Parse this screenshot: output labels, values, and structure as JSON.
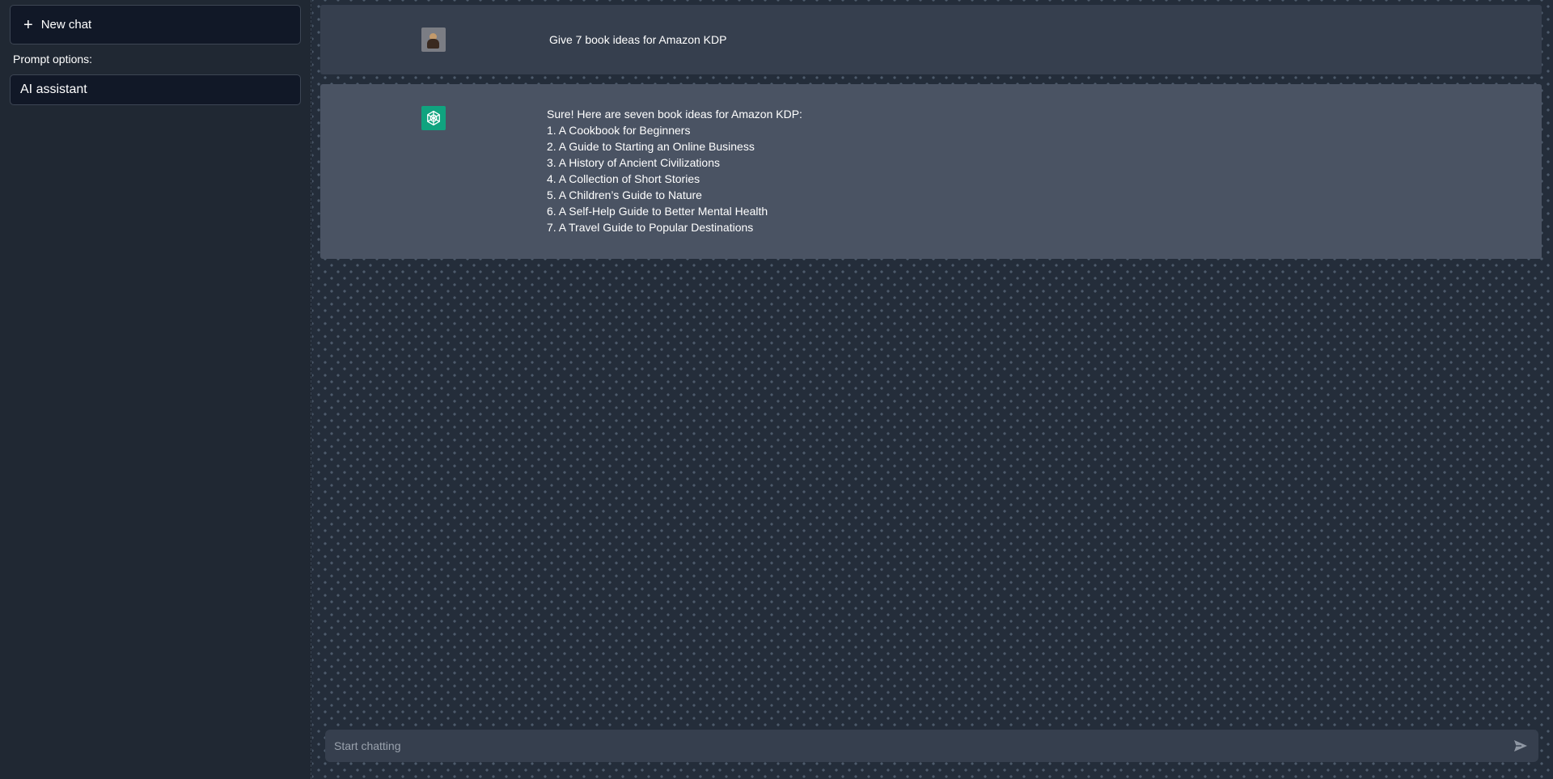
{
  "sidebar": {
    "new_chat_label": "New chat",
    "prompt_options_label": "Prompt options:",
    "prompt_selected": "AI assistant"
  },
  "chat": {
    "user_message": "Give 7 book ideas for Amazon KDP",
    "assistant_lines": [
      "Sure! Here are seven book ideas for Amazon KDP:",
      "1. A Cookbook for Beginners",
      "2. A Guide to Starting an Online Business",
      "3. A History of Ancient Civilizations",
      "4. A Collection of Short Stories",
      "5. A Children’s Guide to Nature",
      "6. A Self-Help Guide to Better Mental Health",
      "7. A Travel Guide to Popular Destinations"
    ]
  },
  "input": {
    "placeholder": "Start chatting",
    "value": ""
  },
  "icons": {
    "plus": "plus-icon",
    "user_avatar": "user-avatar-icon",
    "assistant_avatar": "openai-logo-icon",
    "send": "send-icon"
  },
  "colors": {
    "accent": "#10a37f",
    "sidebar_bg": "#202833",
    "user_msg_bg": "#363f4e",
    "assistant_msg_bg": "#4a5363"
  }
}
